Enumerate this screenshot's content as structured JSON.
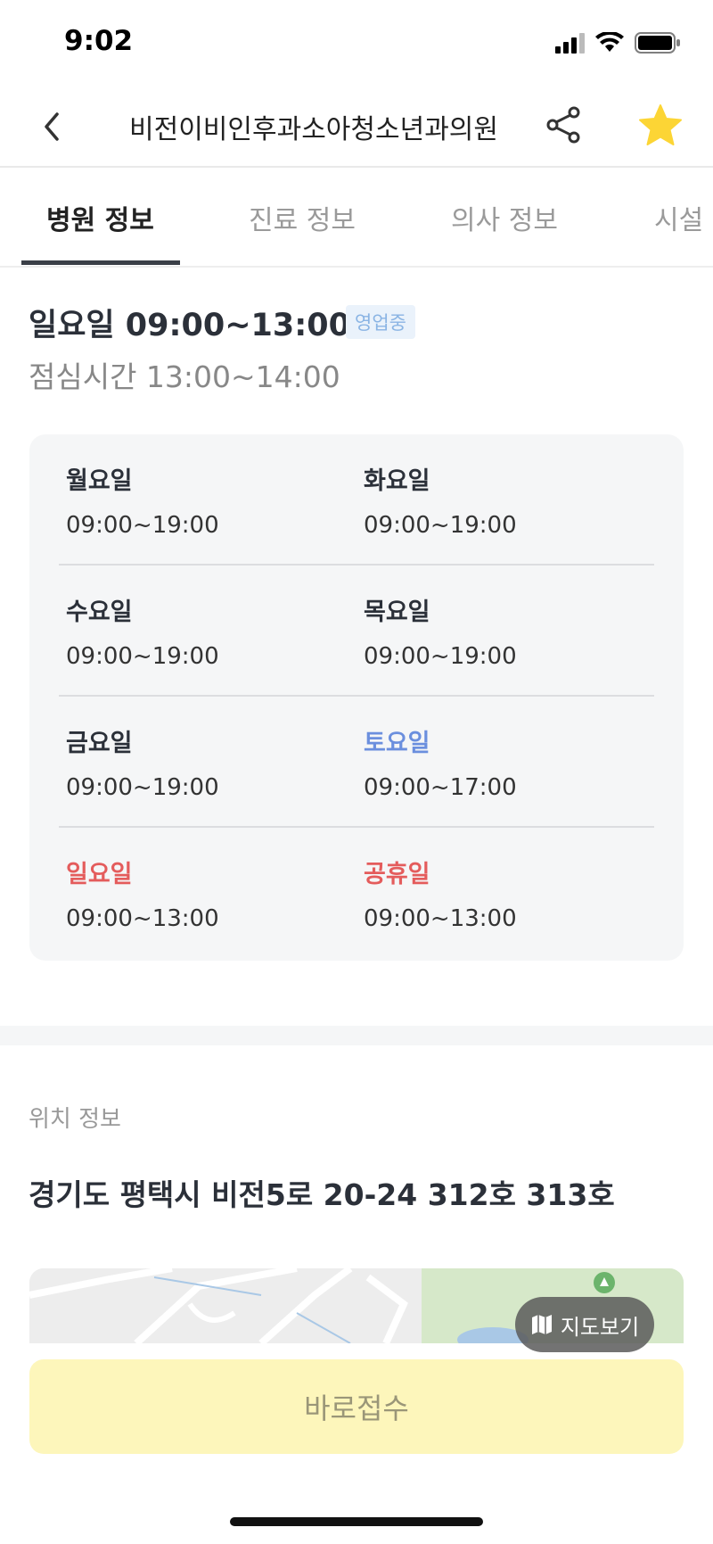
{
  "status_bar": {
    "time": "9:02"
  },
  "header": {
    "title": "비전이비인후과소아청소년과의원"
  },
  "tabs": [
    {
      "label": "병원 정보"
    },
    {
      "label": "진료 정보"
    },
    {
      "label": "의사 정보"
    },
    {
      "label": "시설"
    }
  ],
  "today": {
    "hours": "일요일 09:00~13:00",
    "badge": "영업중",
    "lunch": "점심시간 13:00~14:00"
  },
  "schedule": [
    {
      "day": "월요일",
      "hours": "09:00~19:00"
    },
    {
      "day": "화요일",
      "hours": "09:00~19:00"
    },
    {
      "day": "수요일",
      "hours": "09:00~19:00"
    },
    {
      "day": "목요일",
      "hours": "09:00~19:00"
    },
    {
      "day": "금요일",
      "hours": "09:00~19:00"
    },
    {
      "day": "토요일",
      "hours": "09:00~17:00"
    },
    {
      "day": "일요일",
      "hours": "09:00~13:00"
    },
    {
      "day": "공휴일",
      "hours": "09:00~13:00"
    }
  ],
  "location": {
    "label": "위치 정보",
    "address": "경기도 평택시 비전5로 20-24 312호 313호",
    "map_button": "지도보기"
  },
  "cta": {
    "label": "바로접수"
  },
  "colors": {
    "saturday": "#6b8fde",
    "holiday": "#e45c5c",
    "badge_bg": "#eaf2fb",
    "cta_bg": "#fdf6bb",
    "star": "#fcd535"
  }
}
